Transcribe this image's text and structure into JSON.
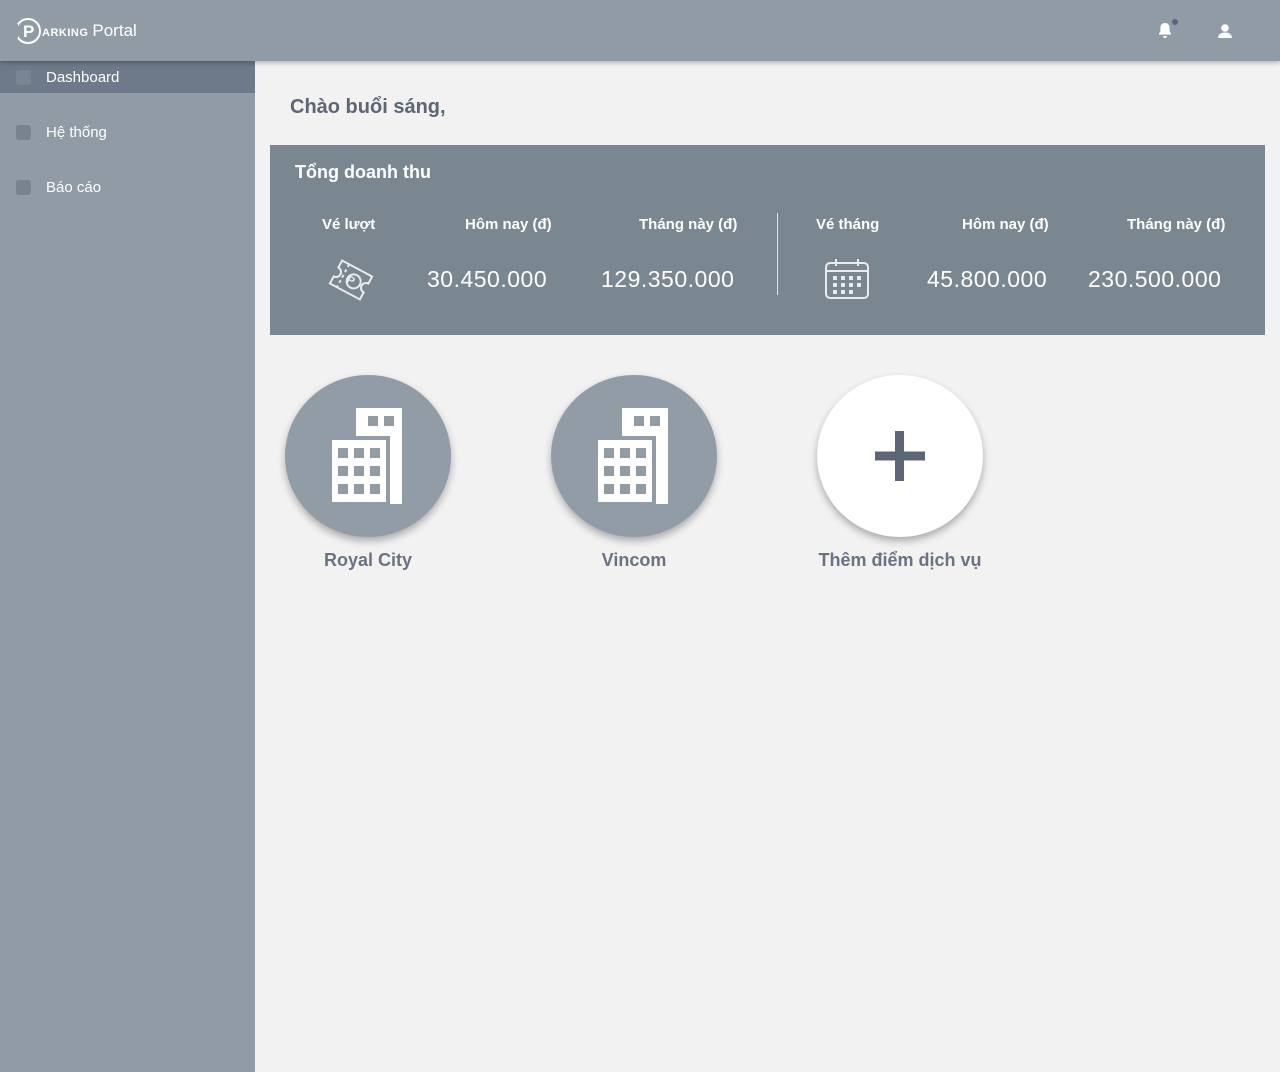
{
  "header": {
    "logo_text": "ARKING",
    "logo_suffix": "Portal",
    "notification_icon": "bell-icon",
    "user_icon": "user-icon"
  },
  "sidebar": {
    "items": [
      {
        "label": "Dashboard",
        "active": true
      },
      {
        "label": "Hệ thống",
        "active": false
      },
      {
        "label": "Báo cáo",
        "active": false
      }
    ]
  },
  "main": {
    "greeting": "Chào buổi sáng,",
    "revenue": {
      "title": "Tổng doanh thu",
      "turn": {
        "label": "Vé lượt",
        "icon": "parking-ticket-icon",
        "today_label": "Hôm nay (đ)",
        "today_value": "30.450.000",
        "month_label": "Tháng này (đ)",
        "month_value": "129.350.000"
      },
      "monthly": {
        "label": "Vé tháng",
        "icon": "calendar-icon",
        "today_label": "Hôm nay (đ)",
        "today_value": "45.800.000",
        "month_label": "Tháng này (đ)",
        "month_value": "230.500.000"
      }
    },
    "sites": [
      {
        "name": "Royal City",
        "icon": "building-icon"
      },
      {
        "name": "Vincom",
        "icon": "building-icon"
      }
    ],
    "add_site": {
      "label": "Thêm điểm dịch vụ",
      "icon": "plus-icon"
    }
  },
  "colors": {
    "bar": "#919ba5",
    "sidebar_active": "#6e798a",
    "panel": "#7a8690",
    "background": "#f2f2f2",
    "text_dark": "#5d6677"
  }
}
